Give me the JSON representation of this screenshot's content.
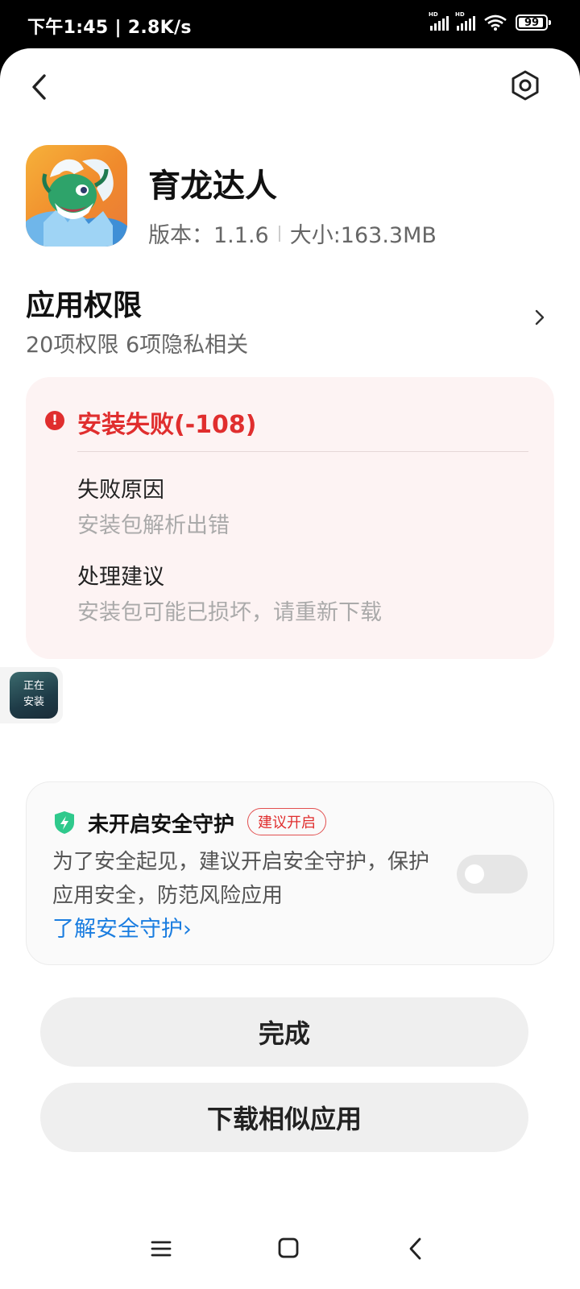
{
  "status_bar": {
    "time_speed": "下午1:45 | 2.8K/s",
    "hd_label": "HD",
    "battery": "99"
  },
  "icons": {
    "back": "chevron-left-icon",
    "settings": "hexagon-settings-icon",
    "error": "exclamation-circle-icon",
    "shield": "shield-lightning-icon"
  },
  "app": {
    "name": "育龙达人",
    "version": "版本：1.1.6",
    "size": "大小:163.3MB"
  },
  "permissions": {
    "title": "应用权限",
    "summary": "20项权限 6项隐私相关"
  },
  "install_result": {
    "title": "安装失败(-108)",
    "reason_label": "失败原因",
    "reason_value": "安装包解析出错",
    "advice_label": "处理建议",
    "advice_value": "安装包可能已损坏，请重新下载"
  },
  "installing_float": {
    "line1": "正在",
    "line2": "安装"
  },
  "security": {
    "title": "未开启安全守护",
    "badge": "建议开启",
    "description": "为了安全起见，建议开启安全守护，保护应用安全，防范风险应用",
    "link": "了解安全守护›",
    "toggle_on": false
  },
  "buttons": {
    "done": "完成",
    "download_similar": "下载相似应用"
  },
  "colors": {
    "error_red": "#e02e2e",
    "link_blue": "#1a7de0",
    "shield_green": "#2fc98c"
  }
}
